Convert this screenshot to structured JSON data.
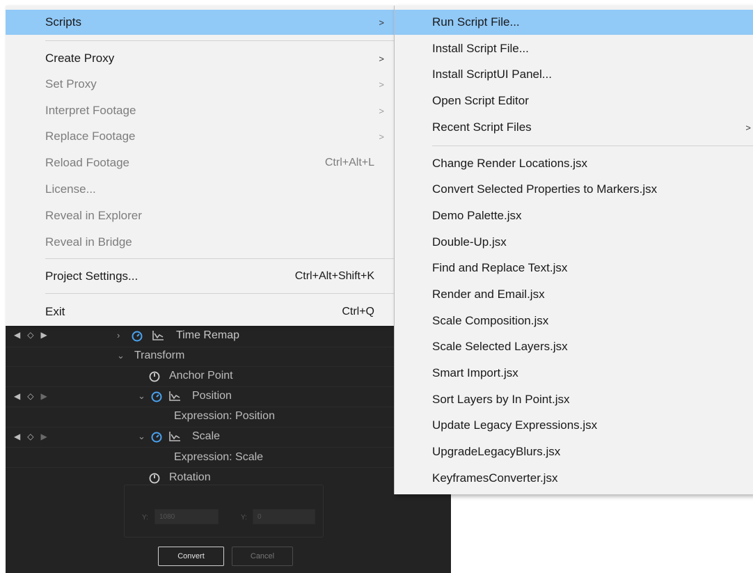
{
  "main_menu": {
    "items": [
      {
        "label": "Scripts",
        "shortcut": "",
        "submenu": true,
        "enabled": true,
        "highlighted": true
      },
      {
        "label": "Create Proxy",
        "shortcut": "",
        "submenu": true,
        "enabled": true
      },
      {
        "label": "Set Proxy",
        "shortcut": "",
        "submenu": true,
        "enabled": false
      },
      {
        "label": "Interpret Footage",
        "shortcut": "",
        "submenu": true,
        "enabled": false
      },
      {
        "label": "Replace Footage",
        "shortcut": "",
        "submenu": true,
        "enabled": false
      },
      {
        "label": "Reload Footage",
        "shortcut": "Ctrl+Alt+L",
        "submenu": false,
        "enabled": false
      },
      {
        "label": "License...",
        "shortcut": "",
        "submenu": false,
        "enabled": false
      },
      {
        "label": "Reveal in Explorer",
        "shortcut": "",
        "submenu": false,
        "enabled": false
      },
      {
        "label": "Reveal in Bridge",
        "shortcut": "",
        "submenu": false,
        "enabled": false
      },
      {
        "label": "Project Settings...",
        "shortcut": "Ctrl+Alt+Shift+K",
        "submenu": false,
        "enabled": true
      },
      {
        "label": "Exit",
        "shortcut": "Ctrl+Q",
        "submenu": false,
        "enabled": true
      }
    ]
  },
  "scripts_submenu": {
    "items": [
      {
        "label": "Run Script File...",
        "highlighted": true
      },
      {
        "label": "Install Script File..."
      },
      {
        "label": "Install ScriptUI Panel..."
      },
      {
        "label": "Open Script Editor"
      },
      {
        "label": "Recent Script Files",
        "submenu": true
      },
      {
        "label": "Change Render Locations.jsx"
      },
      {
        "label": "Convert Selected Properties to Markers.jsx"
      },
      {
        "label": "Demo Palette.jsx"
      },
      {
        "label": "Double-Up.jsx"
      },
      {
        "label": "Find and Replace Text.jsx"
      },
      {
        "label": "Render and Email.jsx"
      },
      {
        "label": "Scale Composition.jsx"
      },
      {
        "label": "Scale Selected Layers.jsx"
      },
      {
        "label": "Smart Import.jsx"
      },
      {
        "label": "Sort Layers by In Point.jsx"
      },
      {
        "label": "Update Legacy Expressions.jsx"
      },
      {
        "label": "UpgradeLegacyBlurs.jsx"
      },
      {
        "label": "KeyframesConverter.jsx"
      }
    ]
  },
  "arrow_glyph": ">",
  "timeline": {
    "time_remap": "Time Remap",
    "transform": "Transform",
    "anchor_point": "Anchor Point",
    "position": "Position",
    "expression_position": "Expression: Position",
    "scale": "Scale",
    "expression_scale": "Expression: Scale",
    "rotation": "Rotation"
  },
  "dialog": {
    "y_label_1": "Y:",
    "y_value_1": "1080",
    "y_label_2": "Y:",
    "y_value_2": "0",
    "convert_label": "Convert",
    "cancel_label": "Cancel"
  },
  "colors": {
    "highlight": "#91c9f7",
    "stopwatch_active": "#4aa3f0",
    "panel_bg": "#232323",
    "menu_bg": "#f2f2f2"
  }
}
